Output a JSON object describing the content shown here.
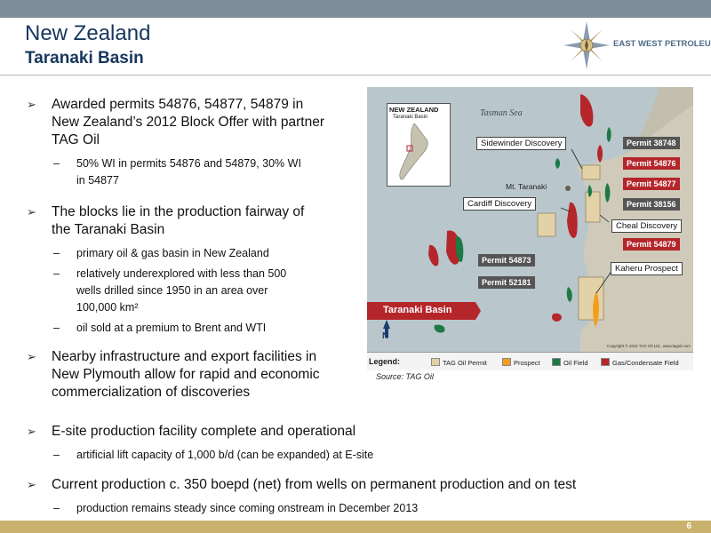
{
  "header": {
    "title": "New Zealand",
    "subtitle": "Taranaki Basin",
    "logo_text": "EAST WEST PETROLEUM"
  },
  "bullets": [
    {
      "lines": [
        "Awarded permits 54876, 54877, 54879 in",
        "New Zealand’s 2012 Block Offer with partner",
        "TAG Oil"
      ],
      "subs": [
        {
          "lines": [
            "50% WI in permits 54876 and 54879, 30% WI",
            "in 54877"
          ]
        }
      ]
    },
    {
      "lines": [
        "The blocks lie in the production fairway of",
        "the Taranaki Basin"
      ],
      "subs": [
        {
          "lines": [
            "primary oil & gas basin in New Zealand"
          ]
        },
        {
          "lines": [
            "relatively underexplored with less than 500",
            "wells drilled since 1950 in an area over",
            "100,000 km²"
          ]
        },
        {
          "lines": [
            "oil sold at a premium to Brent and WTI"
          ]
        }
      ]
    },
    {
      "lines": [
        "Nearby infrastructure and export facilities in",
        "New Plymouth allow for rapid and economic",
        "commercialization of discoveries"
      ],
      "subs": []
    },
    {
      "lines": [
        "E-site production facility complete and operational"
      ],
      "subs": [
        {
          "lines": [
            "artificial lift capacity of 1,000 b/d (can be expanded) at E-site"
          ]
        }
      ]
    },
    {
      "lines": [
        "Current production c. 350 boepd (net) from wells on permanent production and on test"
      ],
      "subs": [
        {
          "lines": [
            "production remains steady since coming onstream in December 2013"
          ]
        }
      ]
    }
  ],
  "map": {
    "inset_title": "NEW ZEALAND",
    "inset_subtitle": "Taranaki Basin",
    "sea_label": "Tasman Sea",
    "mountain_label": "Mt. Taranaki",
    "basin_label": "Taranaki Basin",
    "north_label": "N",
    "copyright": "Copyright © 2011 TAG Oil Ltd., www.tagoil.com",
    "callouts": [
      "Sidewinder Discovery",
      "Cardiff Discovery",
      "Cheal Discovery",
      "Kaheru Prospect"
    ],
    "permits": [
      {
        "label": "Permit 38748",
        "color": "#555555"
      },
      {
        "label": "Permit 54876",
        "color": "#b5262b"
      },
      {
        "label": "Permit 54877",
        "color": "#b5262b"
      },
      {
        "label": "Permit 38156",
        "color": "#555555"
      },
      {
        "label": "Permit 54879",
        "color": "#b5262b"
      },
      {
        "label": "Permit 54873",
        "color": "#555555"
      },
      {
        "label": "Permit 52181",
        "color": "#555555"
      }
    ],
    "legend": {
      "title": "Legend:",
      "items": [
        {
          "label": "TAG Oil Permit",
          "color": "#e3d2a8"
        },
        {
          "label": "Prospect",
          "color": "#f39c1f"
        },
        {
          "label": "Oil Field",
          "color": "#1e7a45"
        },
        {
          "label": "Gas/Condensate Field",
          "color": "#b5262b"
        }
      ]
    },
    "source": "Source: TAG Oil"
  },
  "page_number": "6"
}
